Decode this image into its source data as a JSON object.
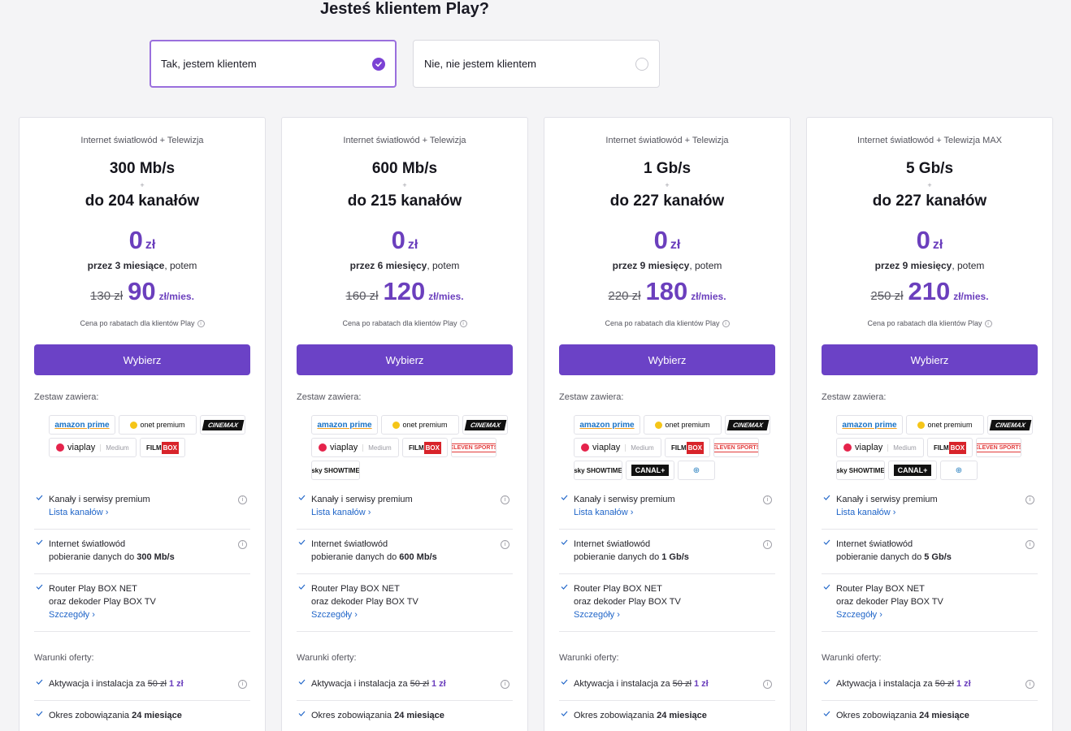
{
  "question": "Jesteś klientem Play?",
  "choices": [
    {
      "label": "Tak, jestem klientem",
      "selected": true
    },
    {
      "label": "Nie, nie jestem klientem",
      "selected": false
    }
  ],
  "common": {
    "plus": "+",
    "zero": "0",
    "zl": "zł",
    "per_month": "zł/mies.",
    "old_currency": "zł",
    "price_note": "Cena po rabatach dla klientów Play",
    "info_glyph": "i",
    "select_label": "Wybierz",
    "set_label": "Zestaw zawiera:",
    "conditions_label": "Warunki oferty:",
    "then": ", potem",
    "f_premium": "Kanały i serwisy premium",
    "f_channel_list": "Lista kanałów",
    "f_internet": "Internet światłowód",
    "f_download": "pobieranie danych do ",
    "f_router": "Router Play BOX NET",
    "f_decoder": "oraz dekoder Play BOX TV",
    "f_details": "Szczegóły",
    "f_activation": "Aktywacja i instalacja za ",
    "f_activation_old": "50 zł",
    "f_activation_new": "1 zł",
    "f_commitment": "Okres zobowiązania ",
    "f_commitment_val": "24 miesiące",
    "logo_amazon": "amazon prime",
    "logo_onet": "onet premium",
    "logo_cinemax": "CINEMAX",
    "logo_viaplay": "viaplay",
    "logo_viaplay_tier": "Medium",
    "logo_filmbox_a": "FILM",
    "logo_filmbox_b": "BOX",
    "logo_eleven": "ELEVEN SPORTS",
    "logo_sky": "sky SHOWTIME",
    "logo_canal": "CANAL+",
    "logo_polsat": "⊕"
  },
  "plans": [
    {
      "category": "Internet światłowód + Telewizja",
      "speed": "300 Mb/s",
      "channels": "do 204 kanałów",
      "promo_period": "przez 3 miesiące",
      "old_price": "130",
      "new_price": "90",
      "download": "300 Mb/s"
    },
    {
      "category": "Internet światłowód + Telewizja",
      "speed": "600 Mb/s",
      "channels": "do 215 kanałów",
      "promo_period": "przez 6 miesięcy",
      "old_price": "160",
      "new_price": "120",
      "download": "600 Mb/s"
    },
    {
      "category": "Internet światłowód + Telewizja",
      "speed": "1 Gb/s",
      "channels": "do 227 kanałów",
      "promo_period": "przez 9 miesięcy",
      "old_price": "220",
      "new_price": "180",
      "download": "1 Gb/s"
    },
    {
      "category": "Internet światłowód + Telewizja MAX",
      "speed": "5 Gb/s",
      "channels": "do 227 kanałów",
      "promo_period": "przez 9 miesięcy",
      "old_price": "250",
      "new_price": "210",
      "download": "5 Gb/s"
    }
  ],
  "colors": {
    "accent": "#6b42c6",
    "price_purple": "#6b3fbd",
    "link": "#2166c9",
    "selected_border": "#9a6fdd"
  }
}
